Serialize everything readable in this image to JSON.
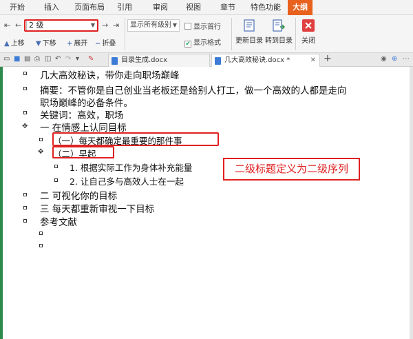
{
  "menu": {
    "tabs": [
      "开始",
      "插入",
      "页面布局",
      "引用",
      "审阅",
      "视图",
      "章节",
      "特色功能",
      "大纲"
    ],
    "active": "大纲"
  },
  "ribbon": {
    "level_select": "2 级",
    "show_level": "显示所有级别",
    "show_first_line": "显示首行",
    "show_format": "显示格式",
    "move_up": "上移",
    "move_down": "下移",
    "expand": "展开",
    "collapse": "折叠",
    "update_toc": "更新目录",
    "goto_toc": "转到目录",
    "close": "关闭"
  },
  "doc_tabs": [
    {
      "label": "目录生成.docx"
    },
    {
      "label": "几大高效秘诀.docx *"
    }
  ],
  "outline": {
    "title": "几大高效秘诀，带你走向职场巅峰",
    "abstract_line1": "摘要：不管你是自己创业当老板还是给别人打工，做一个高效的人都是走向",
    "abstract_line2": "职场巅峰的必备条件。",
    "keywords": "关键词：高效，职场",
    "h1_1": "一  在情感上认同目标",
    "h2_1": "（一）每天都确定最重要的那件事",
    "h2_2": "（二）早起",
    "h3_1": "1. 根据实际工作为身体补充能量",
    "h3_2": "2. 让自己多与高效人士在一起",
    "h1_2": "二  可视化你的目标",
    "h1_3": "三  每天都重新审视一下目标",
    "refs": "参考文献"
  },
  "annotation": "二级标题定义为二级序列"
}
